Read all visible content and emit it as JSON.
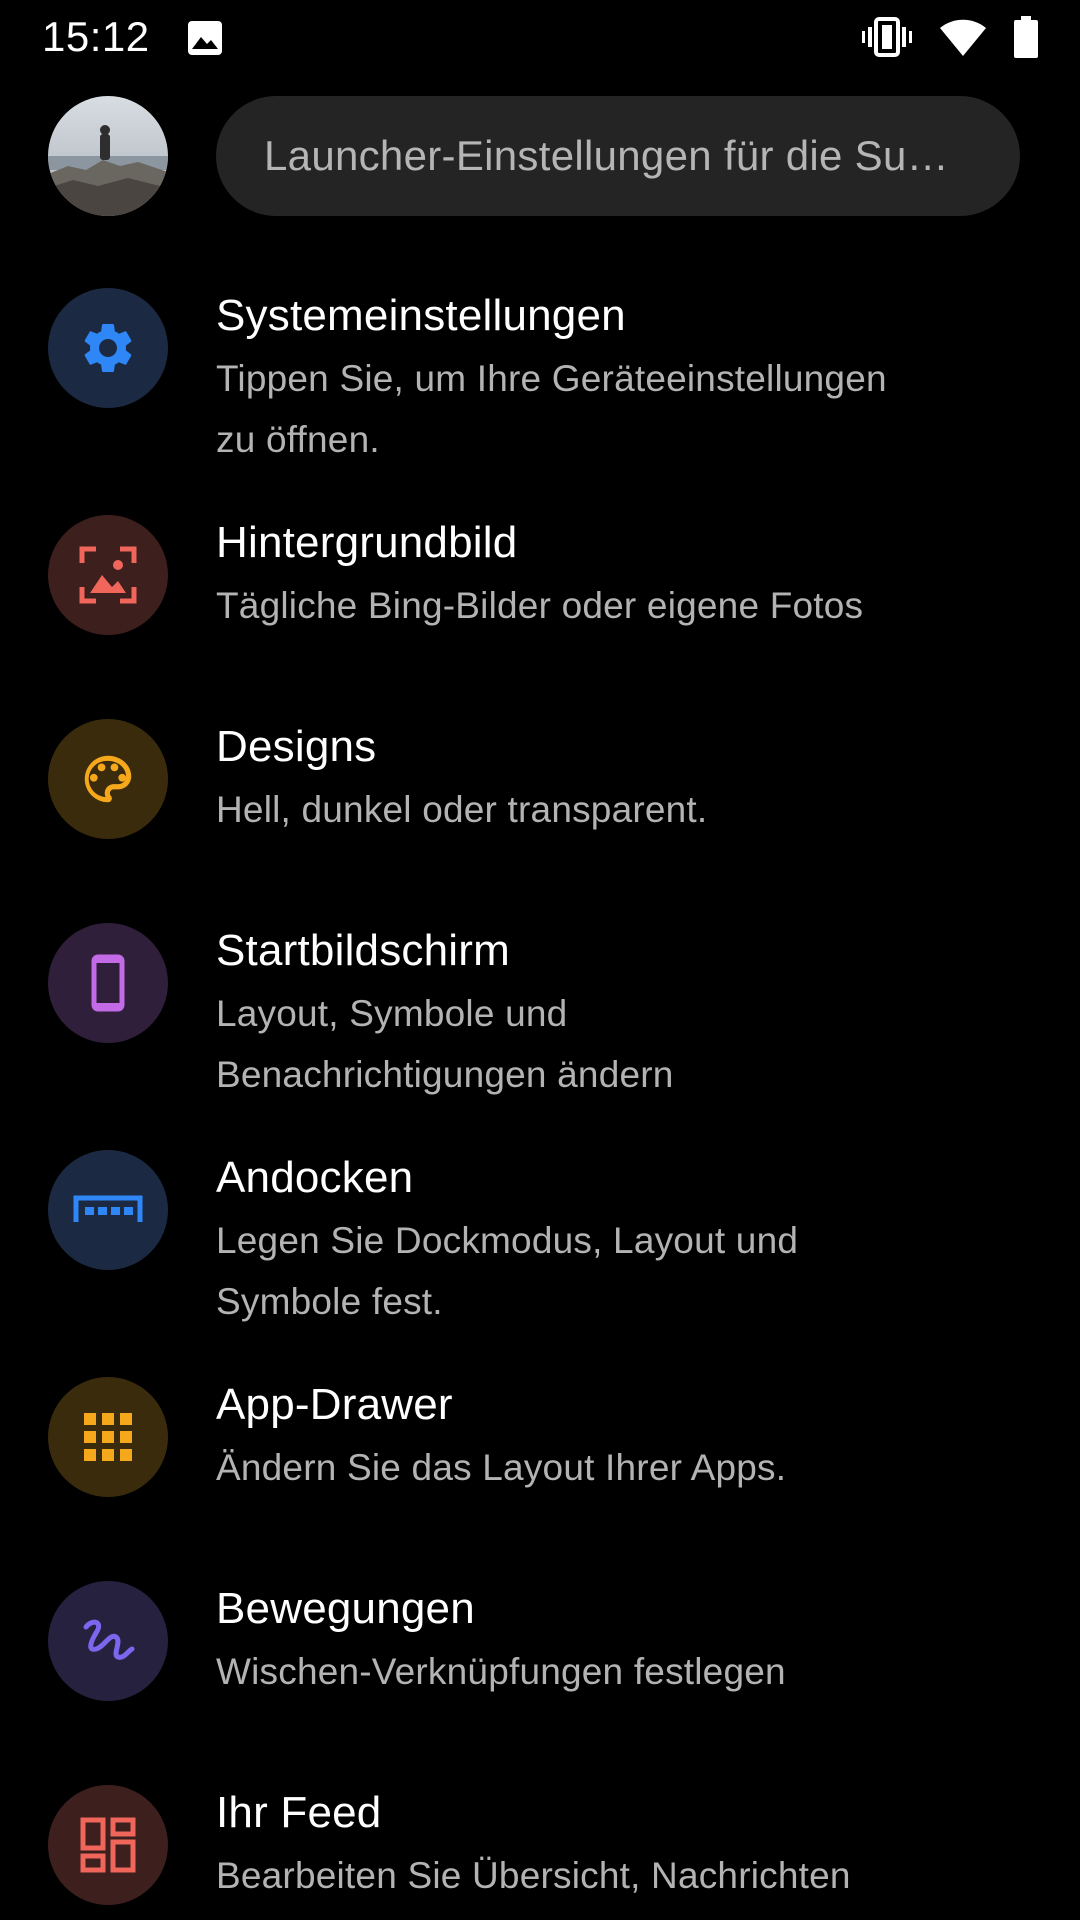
{
  "status_bar": {
    "time": "15:12",
    "icons": [
      "gallery-notification-icon",
      "vibrate-icon",
      "wifi-icon",
      "battery-icon"
    ]
  },
  "header": {
    "avatar": "profile-photo",
    "search_placeholder": "Launcher-Einstellungen für die Su…"
  },
  "colors": {
    "background": "#000000",
    "search_box": "#242424",
    "title_text": "#ffffff",
    "subtitle_text": "#b3b3b3"
  },
  "settings": [
    {
      "title": "Systemeinstellungen",
      "subtitle_lines": [
        "Tippen Sie, um Ihre Geräteeinstellungen",
        "zu öffnen."
      ],
      "icon": "gear-icon",
      "icon_color": "#2f86f6",
      "icon_bg": "#1b2a42"
    },
    {
      "title": "Hintergrundbild",
      "subtitle_lines": [
        "Tägliche Bing-Bilder oder eigene Fotos"
      ],
      "icon": "wallpaper-icon",
      "icon_color": "#f0665a",
      "icon_bg": "#3d1f1d"
    },
    {
      "title": "Designs",
      "subtitle_lines": [
        "Hell, dunkel oder transparent."
      ],
      "icon": "palette-icon",
      "icon_color": "#f6a81c",
      "icon_bg": "#3b2b0d"
    },
    {
      "title": "Startbildschirm",
      "subtitle_lines": [
        "Layout, Symbole und",
        "Benachrichtigungen ändern"
      ],
      "icon": "phone-icon",
      "icon_color": "#c36ae6",
      "icon_bg": "#2f1f3b"
    },
    {
      "title": "Andocken",
      "subtitle_lines": [
        "Legen Sie Dockmodus, Layout und",
        "Symbole fest."
      ],
      "icon": "dock-icon",
      "icon_color": "#2f86f6",
      "icon_bg": "#1b2a42"
    },
    {
      "title": "App-Drawer",
      "subtitle_lines": [
        "Ändern Sie das Layout Ihrer Apps."
      ],
      "icon": "app-grid-icon",
      "icon_color": "#f6a81c",
      "icon_bg": "#3b2b0d"
    },
    {
      "title": "Bewegungen",
      "subtitle_lines": [
        "Wischen-Verknüpfungen festlegen"
      ],
      "icon": "gesture-icon",
      "icon_color": "#7a67ee",
      "icon_bg": "#26213f"
    },
    {
      "title": "Ihr Feed",
      "subtitle_lines": [
        "Bearbeiten Sie Übersicht, Nachrichten"
      ],
      "icon": "feed-dashboard-icon",
      "icon_color": "#f0665a",
      "icon_bg": "#3d1f1d"
    }
  ]
}
